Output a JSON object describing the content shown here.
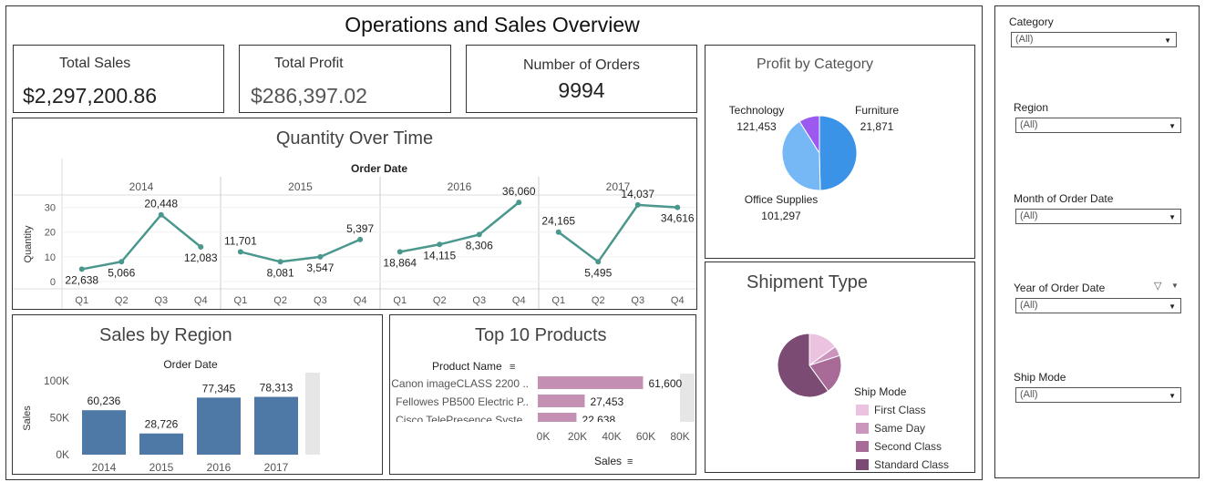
{
  "dashboard": {
    "title": "Operations and Sales Overview"
  },
  "kpis": {
    "total_sales": {
      "label": "Total Sales",
      "value": "$2,297,200.86"
    },
    "total_profit": {
      "label": "Total Profit",
      "value": "$286,397.02"
    },
    "orders": {
      "label": "Number of Orders",
      "value": "9994"
    }
  },
  "quantity_chart": {
    "title": "Quantity Over Time",
    "header": "Order Date",
    "ylabel": "Quantity",
    "years": [
      "2014",
      "2015",
      "2016",
      "2017"
    ],
    "quarters": [
      "Q1",
      "Q2",
      "Q3",
      "Q4"
    ],
    "y_ticks": [
      "30",
      "20",
      "10",
      "0"
    ]
  },
  "profit_chart": {
    "title": "Profit by Category"
  },
  "region_chart": {
    "title": "Sales by Region",
    "header": "Order Date",
    "ylabel": "Sales",
    "y_ticks": [
      "100K",
      "50K",
      "0K"
    ]
  },
  "products_chart": {
    "title": "Top 10 Products",
    "field_label": "Product Name",
    "xlabel": "Sales",
    "x_ticks": [
      "0K",
      "20K",
      "40K",
      "60K",
      "80K"
    ]
  },
  "shipment_chart": {
    "title": "Shipment Type",
    "legend_title": "Ship Mode"
  },
  "filters": [
    {
      "label": "Category",
      "value": "(All)"
    },
    {
      "label": "Region",
      "value": "(All)"
    },
    {
      "label": "Month of Order Date",
      "value": "(All)"
    },
    {
      "label": "Year of Order Date",
      "value": "(All)"
    },
    {
      "label": "Ship Mode",
      "value": "(All)"
    }
  ],
  "colors": {
    "line": "#4a978e",
    "bar": "#4e79a7",
    "product_bar": "#c390b4",
    "pie_technology": "#3b93e8",
    "pie_office": "#76b8f5",
    "pie_furniture": "#9b59f0"
  },
  "chart_data": [
    {
      "type": "line",
      "title": "Quantity Over Time",
      "xlabel": "Order Date",
      "ylabel": "Quantity",
      "categories": [
        "2014 Q1",
        "2014 Q2",
        "2014 Q3",
        "2014 Q4",
        "2015 Q1",
        "2015 Q2",
        "2015 Q3",
        "2015 Q4",
        "2016 Q1",
        "2016 Q2",
        "2016 Q3",
        "2016 Q4",
        "2017 Q1",
        "2017 Q2",
        "2017 Q3",
        "2017 Q4"
      ],
      "values": [
        5,
        8,
        27,
        14,
        12,
        8,
        10,
        17,
        12,
        15,
        19,
        32,
        20,
        8,
        31,
        30
      ],
      "labels": [
        "22,638",
        "5,066",
        "20,448",
        "12,083",
        "11,701",
        "8,081",
        "3,547",
        "5,397",
        "18,864",
        "14,115",
        "8,306",
        "36,060",
        "24,165",
        "5,495",
        "14,037",
        "34,616"
      ],
      "ylim": [
        0,
        35
      ]
    },
    {
      "type": "pie",
      "title": "Profit by Category",
      "slices": [
        {
          "name": "Technology",
          "value": 121453,
          "label": "121,453"
        },
        {
          "name": "Office Supplies",
          "value": 101297,
          "label": "101,297"
        },
        {
          "name": "Furniture",
          "value": 21871,
          "label": "21,871"
        }
      ]
    },
    {
      "type": "bar",
      "title": "Sales by Region",
      "xlabel": "Order Date",
      "ylabel": "Sales",
      "categories": [
        "2014",
        "2015",
        "2016",
        "2017"
      ],
      "values": [
        60236,
        28726,
        77345,
        78313
      ],
      "labels": [
        "60,236",
        "28,726",
        "77,345",
        "78,313"
      ],
      "ylim": [
        0,
        100000
      ]
    },
    {
      "type": "bar",
      "title": "Top 10 Products",
      "xlabel": "Sales",
      "ylabel": "Product Name",
      "categories": [
        "Canon imageCLASS 2200 ..",
        "Fellowes PB500 Electric P..",
        "Cisco TelePresence Syste.."
      ],
      "values": [
        61600,
        27453,
        22638
      ],
      "labels": [
        "61,600",
        "27,453",
        "22,638"
      ],
      "xlim": [
        0,
        90000
      ]
    },
    {
      "type": "pie",
      "title": "Shipment Type",
      "legend_title": "Ship Mode",
      "slices": [
        {
          "name": "First Class",
          "value": 15,
          "color": "#ebc2e0"
        },
        {
          "name": "Same Day",
          "value": 5,
          "color": "#cc95bd"
        },
        {
          "name": "Second Class",
          "value": 20,
          "color": "#a86b97"
        },
        {
          "name": "Standard Class",
          "value": 60,
          "color": "#7b4b73"
        }
      ]
    }
  ]
}
